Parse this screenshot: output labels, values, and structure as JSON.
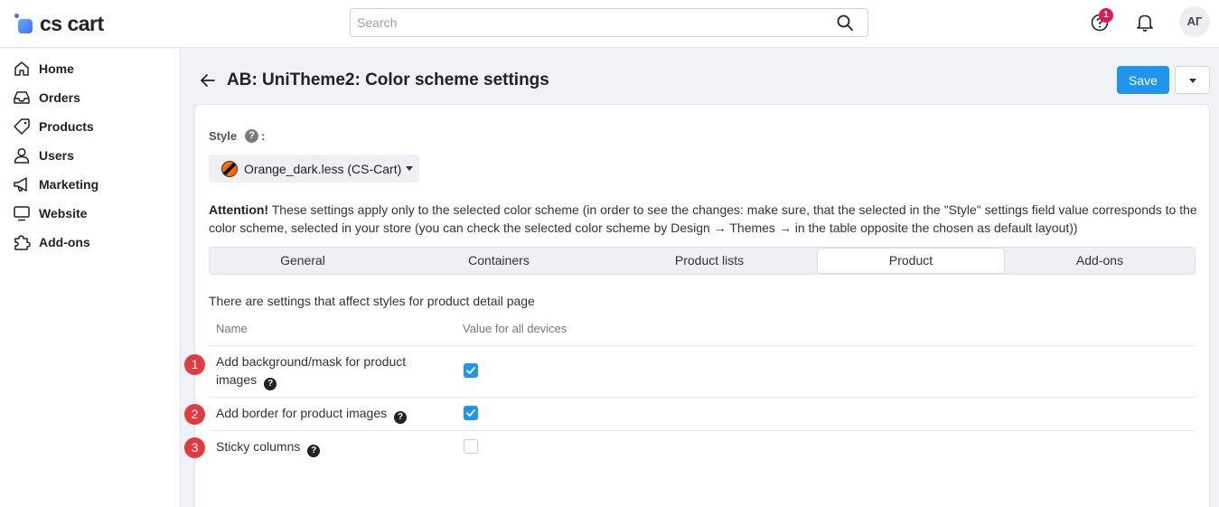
{
  "app": {
    "logo_text": "cs cart"
  },
  "search": {
    "placeholder": "Search"
  },
  "header_icons": {
    "notification_count": "1",
    "avatar_initials": "АГ"
  },
  "sidebar": {
    "items": [
      {
        "label": "Home",
        "icon": "home-icon"
      },
      {
        "label": "Orders",
        "icon": "inbox-icon"
      },
      {
        "label": "Products",
        "icon": "tag-icon"
      },
      {
        "label": "Users",
        "icon": "user-icon"
      },
      {
        "label": "Marketing",
        "icon": "megaphone-icon"
      },
      {
        "label": "Website",
        "icon": "monitor-icon"
      },
      {
        "label": "Add-ons",
        "icon": "puzzle-icon"
      }
    ]
  },
  "page": {
    "title": "AB: UniTheme2: Color scheme settings",
    "save_label": "Save"
  },
  "style_field": {
    "label": "Style",
    "help": "?",
    "colon": ":",
    "selected": "Orange_dark.less (CS-Cart)"
  },
  "attention": {
    "bold": "Attention!",
    "text": " These settings apply only to the selected color scheme (in order to see the changes: make sure, that the selected in the \"Style\" settings field value corresponds to the color scheme, selected in your store (you can check the selected color scheme by Design → Themes → in the table opposite the chosen as default layout))"
  },
  "tabs": [
    {
      "label": "General",
      "active": false
    },
    {
      "label": "Containers",
      "active": false
    },
    {
      "label": "Product lists",
      "active": false
    },
    {
      "label": "Product",
      "active": true
    },
    {
      "label": "Add-ons",
      "active": false
    }
  ],
  "settings": {
    "description": "There are settings that affect styles for product detail page",
    "col_name": "Name",
    "col_value": "Value for all devices",
    "rows": [
      {
        "num": "1",
        "label_line1": "Add background/mask for product",
        "label_line2": "images",
        "checked": true
      },
      {
        "num": "2",
        "label": "Add border for product images",
        "checked": true
      },
      {
        "num": "3",
        "label": "Sticky columns",
        "checked": false
      }
    ],
    "help": "?"
  }
}
